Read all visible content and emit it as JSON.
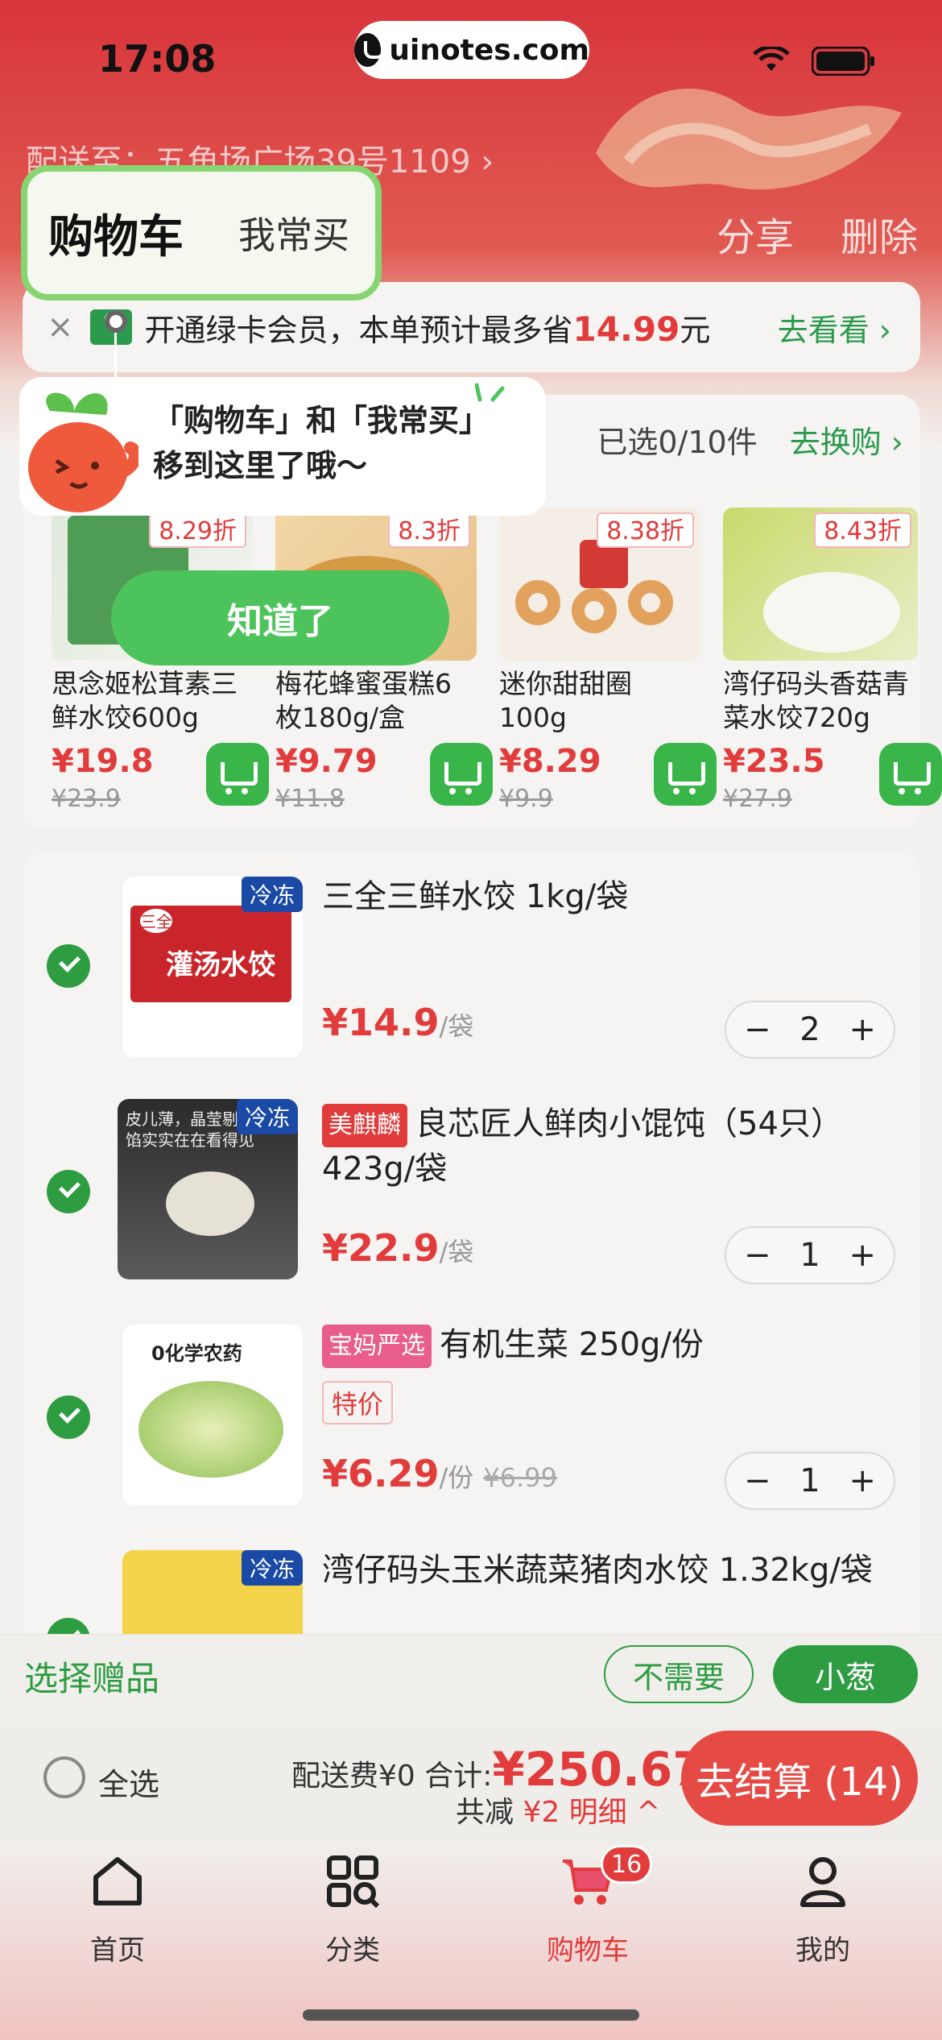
{
  "status_bar": {
    "time": "17:08",
    "watermark": "uinotes.com"
  },
  "header": {
    "address": "配送至：五角场广场39号1109 ›",
    "share": "分享",
    "delete": "删除",
    "tabs": [
      {
        "label": "购物车",
        "active": true
      },
      {
        "label": "我常买",
        "active": false
      }
    ]
  },
  "vip_banner": {
    "close": "×",
    "text_before": "开通绿卡会员，本单预计最多省",
    "amount": "14.99",
    "text_after": "元",
    "link": "去看看 ›"
  },
  "tooltip": {
    "line1": "「购物车」和「我常买」",
    "line2": "移到这里了哦～",
    "button": "知道了"
  },
  "recommend": {
    "selected": "已选0/10件",
    "swap": "去换购 ›",
    "products": [
      {
        "name": "思念姬松茸素三鲜水饺600g",
        "price": "¥19.8",
        "old": "¥23.9",
        "discount": "8.29折"
      },
      {
        "name": "梅花蜂蜜蛋糕6枚180g/盒",
        "price": "¥9.79",
        "old": "¥11.8",
        "discount": "8.3折"
      },
      {
        "name": "迷你甜甜圈 100g",
        "price": "¥8.29",
        "old": "¥9.9",
        "discount": "8.38折"
      },
      {
        "name": "湾仔码头香菇青菜水饺720g",
        "price": "¥23.5",
        "old": "¥27.9",
        "discount": "8.43折"
      }
    ]
  },
  "cart_items": [
    {
      "tag": "",
      "title": "三全三鲜水饺 1kg/袋",
      "price": "¥14.9",
      "unit": "/袋",
      "old": "",
      "qty": "2",
      "badge": "冷冻",
      "promo": ""
    },
    {
      "tag": "美麒麟",
      "title": "良芯匠人鲜肉小馄饨（54只）423g/袋",
      "price": "¥22.9",
      "unit": "/袋",
      "old": "",
      "qty": "1",
      "badge": "冷冻",
      "promo": ""
    },
    {
      "tag": "宝妈严选",
      "title": "有机生菜 250g/份",
      "price": "¥6.29",
      "unit": "/份",
      "old": "¥6.99",
      "qty": "1",
      "badge": "",
      "promo": "特价"
    },
    {
      "tag": "",
      "title": "湾仔码头玉米蔬菜猪肉水饺 1.32kg/袋",
      "price": "",
      "unit": "",
      "old": "",
      "qty": "",
      "badge": "冷冻",
      "promo": ""
    }
  ],
  "thumb_texts": {
    "item1_brand": "三全",
    "item1_title": "灌汤水饺",
    "item2_caption": "皮儿薄，晶莹剔透 肉馅实实在在看得见",
    "item3_caption": "0化学农药"
  },
  "gift_bar": {
    "label": "选择赠品",
    "no_need": "不需要",
    "onion": "小葱"
  },
  "checkout": {
    "select_all": "全选",
    "fee": "配送费¥0 合计:",
    "total": "¥250.67",
    "saved_prefix": "共减",
    "saved_amount": "¥2 明细 ^",
    "pay": "去结算 (14)"
  },
  "tabbar": [
    {
      "label": "首页",
      "icon": "home-icon"
    },
    {
      "label": "分类",
      "icon": "category-icon"
    },
    {
      "label": "购物车",
      "icon": "cart-icon",
      "badge": "16",
      "active": true
    },
    {
      "label": "我的",
      "icon": "profile-icon"
    }
  ],
  "colors": {
    "brand_red": "#e13b3b",
    "brand_green": "#2e9d42",
    "pay_button": "#e64a45"
  }
}
